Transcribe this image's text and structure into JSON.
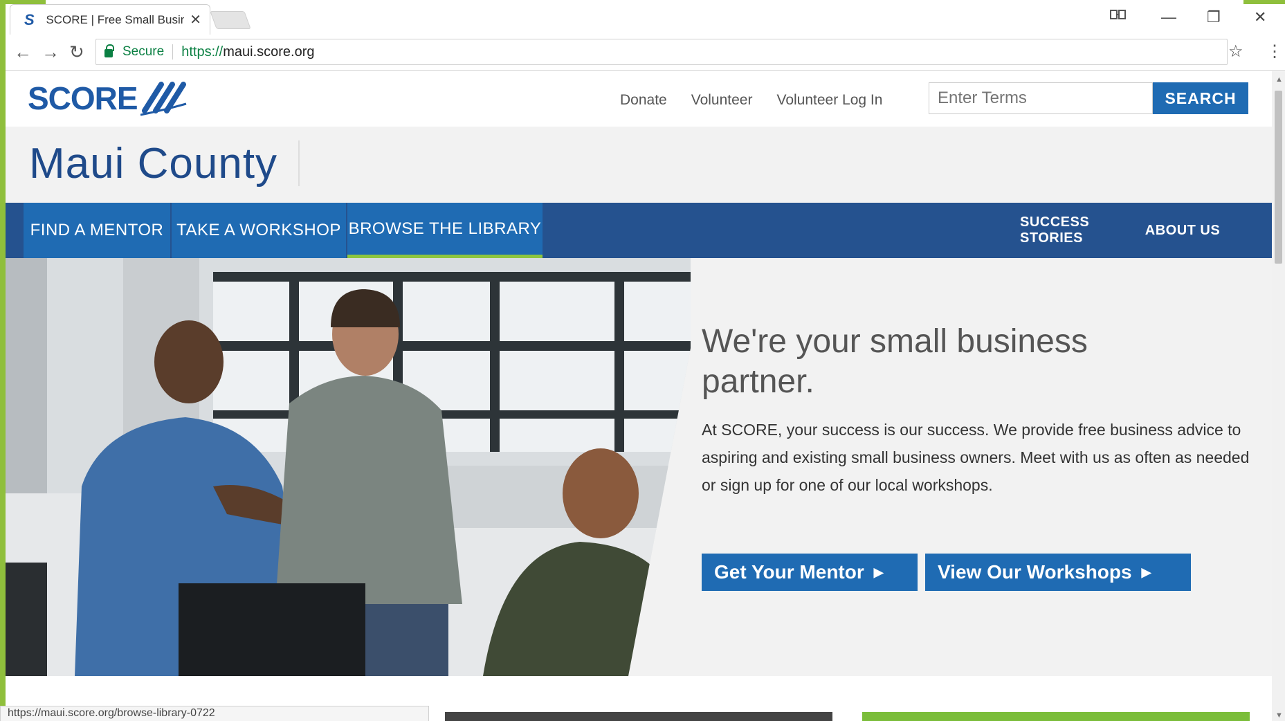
{
  "browser": {
    "tab_title": "SCORE | Free Small Busin",
    "tab_favicon": "S",
    "tab_close": "×",
    "address_secure_label": "Secure",
    "address_url_scheme": "https://",
    "address_url_host": "maui.score.org",
    "status_url": "https://maui.score.org/browse-library-0722",
    "icons": {
      "back": "←",
      "forward": "→",
      "reload": "↻",
      "bookmark": "☆",
      "menu": "⋮",
      "minimize": "—",
      "restore": "❐",
      "close": "✕"
    }
  },
  "header": {
    "logo_text": "SCORE",
    "util_links": [
      "Donate",
      "Volunteer",
      "Volunteer Log In"
    ],
    "search_placeholder": "Enter Terms",
    "search_button": "SEARCH"
  },
  "county": {
    "title": "Maui County"
  },
  "nav": {
    "main_items": [
      "FIND A MENTOR",
      "TAKE A WORKSHOP",
      "BROWSE THE LIBRARY"
    ],
    "active_index": 2,
    "secondary_items": [
      "SUCCESS STORIES",
      "ABOUT US"
    ]
  },
  "hero": {
    "headline": "We're your small business partner.",
    "body": "At SCORE, your success is our success. We provide free business advice to aspiring and existing small business owners. Meet with us as often as needed or sign up for one of our local workshops.",
    "cta_primary": "Get Your Mentor",
    "cta_secondary": "View Our Workshops"
  },
  "colors": {
    "brand_blue": "#1f6bb3",
    "nav_blue": "#25528f",
    "accent_green": "#8dc63f",
    "secure_green": "#0b8043"
  }
}
